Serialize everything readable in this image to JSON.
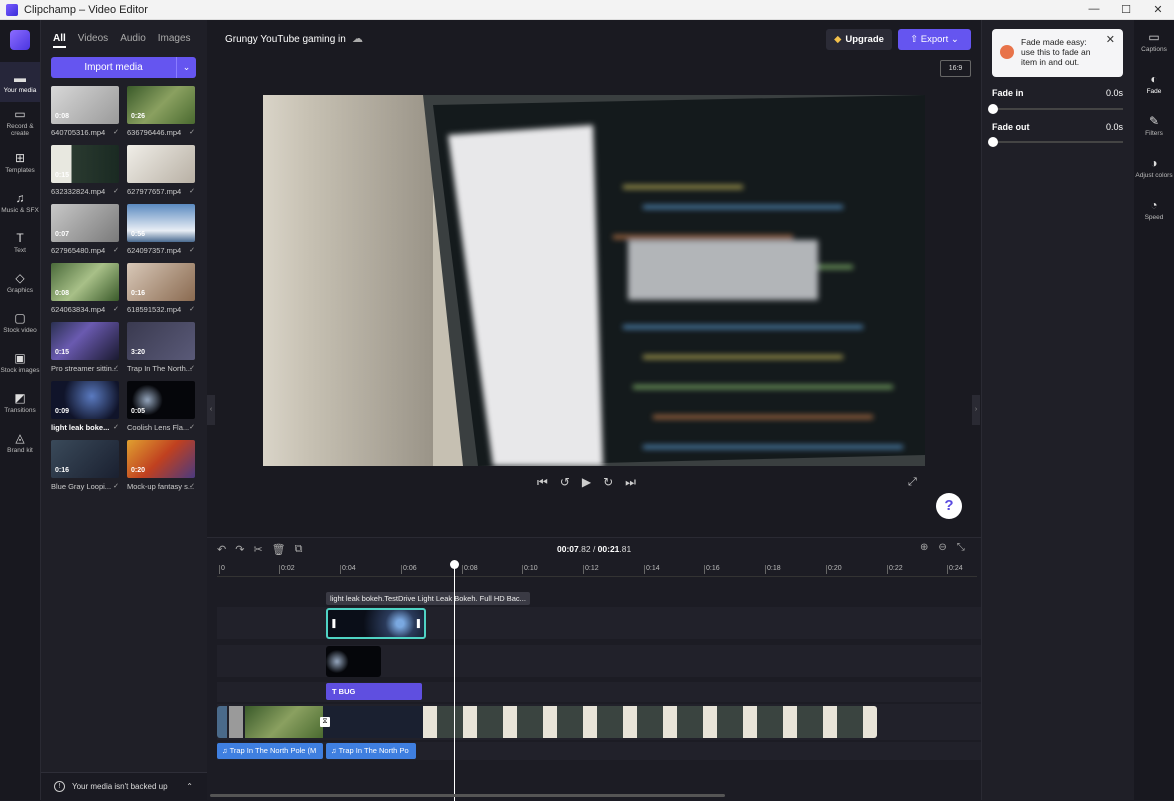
{
  "window": {
    "title": "Clipchamp – Video Editor",
    "controls": [
      "—",
      "☐",
      "✕"
    ]
  },
  "rail": {
    "items": [
      {
        "label": "Your media",
        "icon": "folder-icon"
      },
      {
        "label": "Record & create",
        "icon": "camera-icon"
      },
      {
        "label": "Templates",
        "icon": "templates-icon"
      },
      {
        "label": "Music & SFX",
        "icon": "music-icon"
      },
      {
        "label": "Text",
        "icon": "text-icon"
      },
      {
        "label": "Graphics",
        "icon": "graphics-icon"
      },
      {
        "label": "Stock video",
        "icon": "stock-video-icon"
      },
      {
        "label": "Stock images",
        "icon": "stock-images-icon"
      },
      {
        "label": "Transitions",
        "icon": "transitions-icon"
      },
      {
        "label": "Brand kit",
        "icon": "brand-kit-icon"
      }
    ]
  },
  "media": {
    "tabs": [
      "All",
      "Videos",
      "Audio",
      "Images"
    ],
    "import_label": "Import media",
    "items": [
      {
        "duration": "0:08",
        "name": "640705316.mp4"
      },
      {
        "duration": "0:26",
        "name": "636796446.mp4"
      },
      {
        "duration": "0:15",
        "name": "632332824.mp4"
      },
      {
        "duration": "",
        "name": "627977657.mp4"
      },
      {
        "duration": "0:07",
        "name": "627965480.mp4"
      },
      {
        "duration": "0:56",
        "name": "624097357.mp4"
      },
      {
        "duration": "0:08",
        "name": "624063834.mp4"
      },
      {
        "duration": "0:16",
        "name": "618591532.mp4"
      },
      {
        "duration": "0:15",
        "name": "Pro streamer sittin..."
      },
      {
        "duration": "3:20",
        "name": "Trap In The North..."
      },
      {
        "duration": "0:09",
        "name": "light leak boke..."
      },
      {
        "duration": "0:05",
        "name": "Coolish Lens Fla..."
      },
      {
        "duration": "0:16",
        "name": "Blue Gray Loopi..."
      },
      {
        "duration": "0:20",
        "name": "Mock-up fantasy s..."
      }
    ],
    "backup_text": "Your media isn't backed up"
  },
  "preview": {
    "project_name": "Grungy YouTube gaming in",
    "upgrade_label": "Upgrade",
    "export_label": "Export",
    "aspect_ratio": "16:9",
    "help": "?"
  },
  "timeline": {
    "current_time": "00:07",
    "current_frac": ".82",
    "total_time": "00:21",
    "total_frac": ".81",
    "ticks": [
      "0",
      "0:02",
      "0:04",
      "0:06",
      "0:08",
      "0:10",
      "0:12",
      "0:14",
      "0:16",
      "0:18",
      "0:20",
      "0:22",
      "0:24"
    ],
    "clip_label": "light leak bokeh.TestDrive Light Leak Bokeh. Full HD Bac...",
    "text_clip": "BUG",
    "audio_clips": [
      "Trap In The North Pole (M",
      "Trap In The North Po"
    ]
  },
  "fade": {
    "tip": "Fade made easy: use this to fade an item in and out.",
    "fade_in_label": "Fade in",
    "fade_in_value": "0.0s",
    "fade_out_label": "Fade out",
    "fade_out_value": "0.0s"
  },
  "rrail": {
    "items": [
      {
        "label": "Captions",
        "icon": "captions-icon"
      },
      {
        "label": "Fade",
        "icon": "fade-icon"
      },
      {
        "label": "Filters",
        "icon": "filters-icon"
      },
      {
        "label": "Adjust colors",
        "icon": "adjust-colors-icon"
      },
      {
        "label": "Speed",
        "icon": "speed-icon"
      }
    ]
  },
  "colors": {
    "accent": "#6555f0",
    "audio": "#3f7fe0",
    "panel": "#1f1f27"
  }
}
